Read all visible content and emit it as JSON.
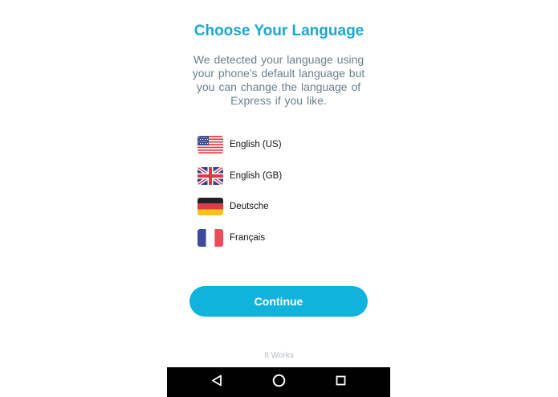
{
  "header": {
    "title": "Choose Your Language",
    "description_lines": [
      "We detected your language using",
      "your phone's default language but",
      "you can change the language of",
      "Express if you like."
    ]
  },
  "languages": [
    {
      "label": "English (US)",
      "flag_icon": "us-flag-icon"
    },
    {
      "label": "English (GB)",
      "flag_icon": "uk-flag-icon"
    },
    {
      "label": "Deutsche",
      "flag_icon": "germany-flag-icon"
    },
    {
      "label": "Français",
      "flag_icon": "france-flag-icon"
    }
  ],
  "continue_label": "Continue",
  "footer_text": "It Works",
  "navbar": {
    "back_icon": "back-triangle-icon",
    "home_icon": "home-circle-icon",
    "recents_icon": "recents-square-icon"
  },
  "colors": {
    "title": "#17a8d0",
    "button": "#0fb3dc",
    "description": "#6b7f8a",
    "navbar": "#000000"
  }
}
